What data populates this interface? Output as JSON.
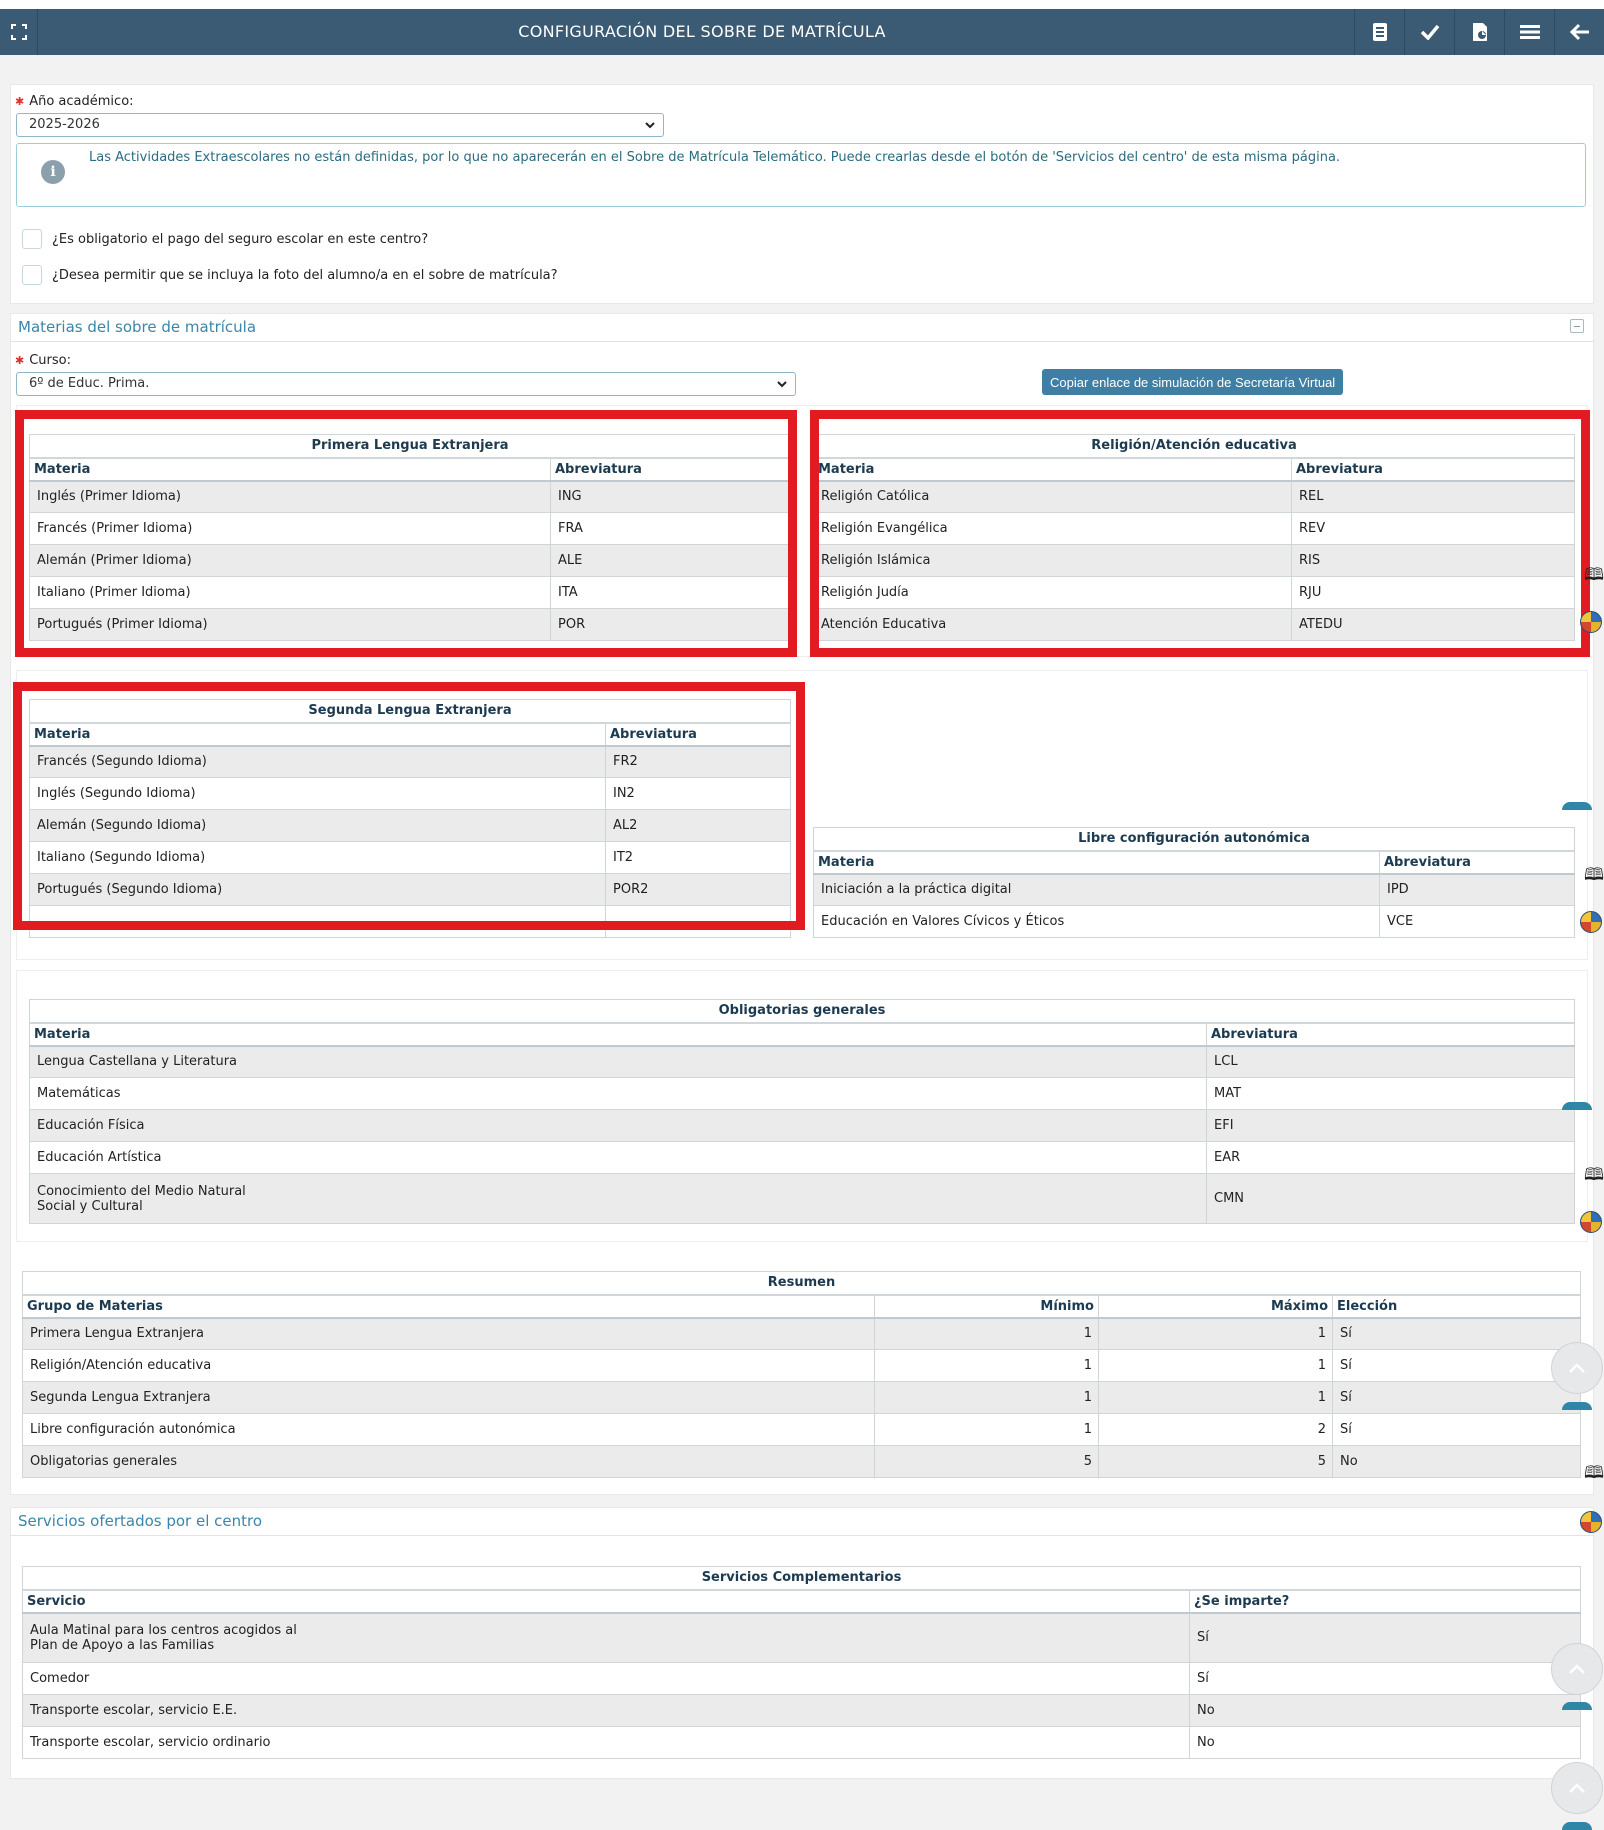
{
  "header": {
    "title": "CONFIGURACIÓN DEL SOBRE DE MATRÍCULA",
    "icons": [
      "fullscreen-icon",
      "document-icon",
      "check-icon",
      "report-icon",
      "list-icon",
      "back-arrow-icon"
    ]
  },
  "form": {
    "academic_year_label": "Año académico:",
    "academic_year_value": "2025-2026",
    "info_message": "Las Actividades Extraescolares no están definidas, por lo que no aparecerán en el Sobre de Matrícula Telemático. Puede crearlas desde el botón de 'Servicios del centro' de esta misma página.",
    "checkbox_insurance": "¿Es obligatorio el pago del seguro escolar en este centro?",
    "checkbox_photo": "¿Desea permitir que se incluya la foto del alumno/a en el sobre de matrícula?"
  },
  "subjects_section": {
    "title": "Materias del sobre de matrícula",
    "course_label": "Curso:",
    "course_value": "6º de Educ. Prima.",
    "copy_button": "Copiar enlace de simulación de Secretaría Virtual"
  },
  "col_materia": "Materia",
  "col_abrev": "Abreviatura",
  "tables": {
    "primera": {
      "title": "Primera Lengua Extranjera",
      "rows": [
        [
          "Inglés (Primer Idioma)",
          "ING"
        ],
        [
          "Francés (Primer Idioma)",
          "FRA"
        ],
        [
          "Alemán (Primer Idioma)",
          "ALE"
        ],
        [
          "Italiano (Primer Idioma)",
          "ITA"
        ],
        [
          "Portugués (Primer Idioma)",
          "POR"
        ]
      ]
    },
    "religion": {
      "title": "Religión/Atención educativa",
      "rows": [
        [
          "Religión Católica",
          "REL"
        ],
        [
          "Religión Evangélica",
          "REV"
        ],
        [
          "Religión Islámica",
          "RIS"
        ],
        [
          "Religión Judía",
          "RJU"
        ],
        [
          "Atención Educativa",
          "ATEDU"
        ]
      ]
    },
    "segunda": {
      "title": "Segunda Lengua Extranjera",
      "rows": [
        [
          "Francés (Segundo Idioma)",
          "FR2"
        ],
        [
          "Inglés (Segundo Idioma)",
          "IN2"
        ],
        [
          "Alemán (Segundo Idioma)",
          "AL2"
        ],
        [
          "Italiano (Segundo Idioma)",
          "IT2"
        ],
        [
          "Portugués (Segundo Idioma)",
          "POR2"
        ]
      ]
    },
    "libre": {
      "title": "Libre configuración autonómica",
      "rows": [
        [
          "Iniciación a la práctica digital",
          "IPD"
        ],
        [
          "Educación en Valores Cívicos y Éticos",
          "VCE"
        ]
      ]
    },
    "obligatorias": {
      "title": "Obligatorias generales",
      "rows": [
        [
          "Lengua Castellana y Literatura",
          "LCL"
        ],
        [
          "Matemáticas",
          "MAT"
        ],
        [
          "Educación Física",
          "EFI"
        ],
        [
          "Educación Artística",
          "EAR"
        ],
        [
          "Conocimiento del Medio Natural Social y Cultural",
          "CMN"
        ]
      ]
    }
  },
  "resumen": {
    "title": "Resumen",
    "columns": [
      "Grupo de Materias",
      "Mínimo",
      "Máximo",
      "Elección"
    ],
    "rows": [
      [
        "Primera Lengua Extranjera",
        "1",
        "1",
        "Sí"
      ],
      [
        "Religión/Atención educativa",
        "1",
        "1",
        "Sí"
      ],
      [
        "Segunda Lengua Extranjera",
        "1",
        "1",
        "Sí"
      ],
      [
        "Libre configuración autonómica",
        "1",
        "2",
        "Sí"
      ],
      [
        "Obligatorias generales",
        "5",
        "5",
        "No"
      ]
    ]
  },
  "services_section": {
    "title": "Servicios ofertados por el centro",
    "table_title": "Servicios Complementarios",
    "columns": [
      "Servicio",
      "¿Se imparte?"
    ],
    "rows": [
      [
        "Aula Matinal para los centros acogidos al Plan de Apoyo a las Familias",
        "Sí"
      ],
      [
        "Comedor",
        "Sí"
      ],
      [
        "Transporte escolar, servicio E.E.",
        "No"
      ],
      [
        "Transporte escolar, servicio ordinario",
        "No"
      ]
    ]
  },
  "colors": {
    "header_bg": "#3b5a73",
    "highlight_red": "#e21a22",
    "accent_blue": "#3b86a8",
    "button_blue": "#3f7fa4"
  }
}
